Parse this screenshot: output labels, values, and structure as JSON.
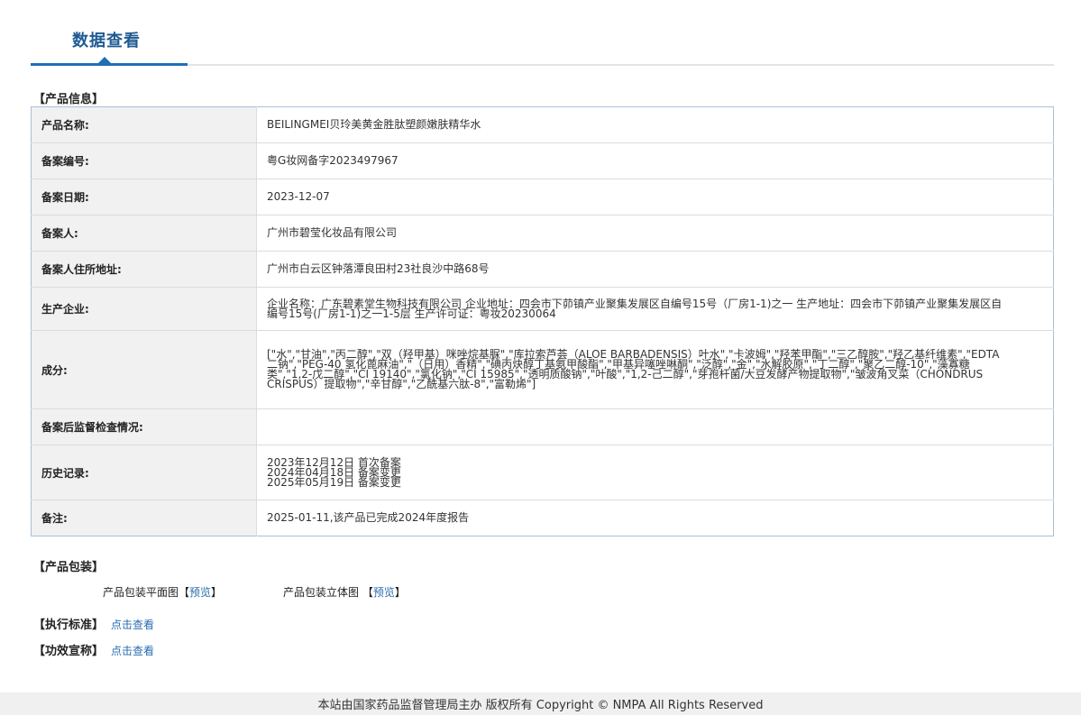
{
  "tab": {
    "title": "数据查看"
  },
  "product_info": {
    "section_title": "【产品信息】",
    "rows": [
      {
        "label": "产品名称:",
        "value": "BEILINGMEI贝玲美黄金胜肽塑颜嫩肤精华水"
      },
      {
        "label": "备案编号:",
        "value": "粤G妆网备字2023497967"
      },
      {
        "label": "备案日期:",
        "value": "2023-12-07"
      },
      {
        "label": "备案人:",
        "value": "广州市碧莹化妆品有限公司"
      },
      {
        "label": "备案人住所地址:",
        "value": "广州市白云区钟落潭良田村23社良沙中路68号"
      },
      {
        "label": "生产企业:",
        "value": "企业名称：广东碧素堂生物科技有限公司 企业地址：四会市下茆镇产业聚集发展区自编号15号（厂房1-1)之一 生产地址：四会市下茆镇产业聚集发展区自编号15号(厂房1-1)之一1-5层 生产许可证：粤妆20230064"
      },
      {
        "label": "成分:",
        "value": "[\"水\",\"甘油\",\"丙二醇\",\"双（羟甲基）咪唑烷基脲\",\"库拉索芦荟（ALOE BARBADENSIS）叶水\",\"卡波姆\",\"羟苯甲酯\",\"三乙醇胺\",\"羟乙基纤维素\",\"EDTA 二钠\",\"PEG-40 氢化蓖麻油\",\"（日用）香精\",\"碘丙炔醇丁基氨甲酸酯\",\"甲基异噻唑啉酮\",\"泛醇\",\"金\",\"水解胶原\",\"丁二醇\",\"聚乙二醇-10\",\"藻寡糖类\",\"1,2-戊二醇\",\"CI 19140\",\"氯化钠\",\"CI 15985\",\"透明质酸钠\",\"叶酸\",\"1,2-己二醇\",\"芽孢杆菌/大豆发酵产物提取物\",\"皱波角叉菜（CHONDRUS CRISPUS）提取物\",\"辛甘醇\",\"乙酰基六肽-8\",\"富勒烯\"]"
      },
      {
        "label": "备案后监督检查情况:",
        "value": ""
      },
      {
        "label": "历史记录:",
        "lines": [
          "2023年12月12日 首次备案",
          "2024年04月18日 备案变更",
          "2025年05月19日 备案变更"
        ]
      },
      {
        "label": "备注:",
        "value": "2025-01-11,该产品已完成2024年度报告"
      }
    ]
  },
  "packaging": {
    "section_title": "【产品包装】",
    "flat_label": "产品包装平面图",
    "solid_label": "产品包装立体图",
    "preview_link": "预览",
    "bracket_open": "【",
    "bracket_close": "】"
  },
  "standard": {
    "section_title": "【执行标准】",
    "link": "点击查看"
  },
  "efficacy": {
    "section_title": "【功效宣称】",
    "link": "点击查看"
  },
  "footer": {
    "text": "本站由国家药品监督管理局主办 版权所有 Copyright © NMPA All Rights Reserved"
  }
}
